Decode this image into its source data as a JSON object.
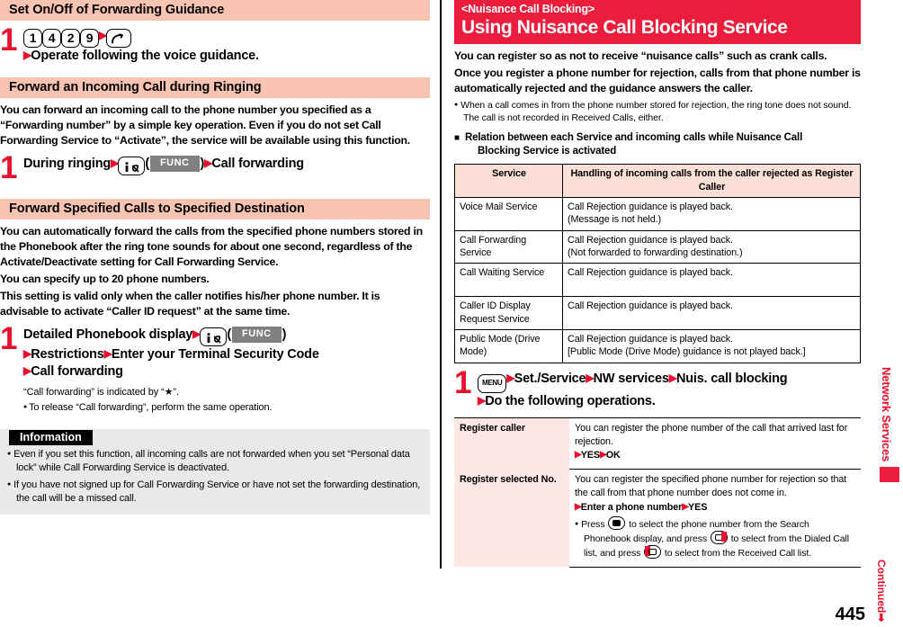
{
  "page": {
    "number": "445",
    "side_tab": "Network Services",
    "continued": "Continued"
  },
  "left": {
    "section1": {
      "heading": "Set On/Off of Forwarding Guidance",
      "step_number": "1",
      "keys": [
        "1",
        "4",
        "2",
        "9"
      ],
      "call_key": "call-key",
      "line2": "Operate following the voice guidance."
    },
    "section2": {
      "heading": "Forward an Incoming Call during Ringing",
      "body": "You can forward an incoming call to the phone number you specified as a “Forwarding number” by a simple key operation. Even if you do not set Call Forwarding Service to “Activate”, the service will be available using this function.",
      "step_number": "1",
      "step_part1": "During ringing",
      "func_label": "FUNC",
      "step_part2": "Call forwarding"
    },
    "section3": {
      "heading": "Forward Specified Calls to Specified Destination",
      "body1": "You can automatically forward the calls from the specified phone numbers stored in the Phonebook after the ring tone sounds for about one second, regardless of the Activate/Deactivate setting for Call Forwarding Service.",
      "body2": "You can specify up to 20 phone numbers.",
      "body3": "This setting is valid only when the caller notifies his/her phone number. It is advisable to activate “Caller ID request” at the same time.",
      "step_number": "1",
      "step_line1a": "Detailed Phonebook display",
      "func_label": "FUNC",
      "step_line2a": "Restrictions",
      "step_line2b": "Enter your Terminal Security Code",
      "step_line3": "Call forwarding",
      "note1": "“Call forwarding” is indicated by “★”.",
      "note2": "To release “Call forwarding”, perform the same operation."
    },
    "information": {
      "label": "Information",
      "items": [
        "Even if you set this function, all incoming calls are not forwarded when you set “Personal data lock” while Call Forwarding Service is deactivated.",
        "If you have not signed up for Call Forwarding Service or have not set the forwarding destination, the call will be a missed call."
      ]
    }
  },
  "right": {
    "banner": {
      "subtitle": "<Nuisance Call Blocking>",
      "title": "Using Nuisance Call Blocking Service"
    },
    "body1": "You can register so as not to receive “nuisance calls” such as crank calls.",
    "body2": "Once you register a phone number for rejection, calls from that phone number is automatically rejected and the guidance answers the caller.",
    "note1": "When a call comes in from the phone number stored for rejection, the ring tone does not sound. The call is not recorded in Received Calls, either.",
    "square_heading_line1": "Relation between each Service and incoming calls while Nuisance Call",
    "square_heading_line2": "Blocking Service is activated",
    "table1": {
      "headers": [
        "Service",
        "Handling of incoming calls from the caller rejected as Register Caller"
      ],
      "rows": [
        {
          "service": "Voice Mail Service",
          "handling": [
            "Call Rejection guidance is played back.",
            "(Message is not held.)"
          ]
        },
        {
          "service": "Call Forwarding Service",
          "handling": [
            "Call Rejection guidance is played back.",
            "(Not forwarded to forwarding destination.)"
          ]
        },
        {
          "service": "Call Waiting Service",
          "handling": [
            "Call Rejection guidance is played back."
          ]
        },
        {
          "service": "Caller ID Display Request Service",
          "handling": [
            "Call Rejection guidance is played back."
          ]
        },
        {
          "service": "Public Mode (Drive Mode)",
          "handling": [
            "Call Rejection guidance is played back.",
            "[Public Mode (Drive Mode) guidance is not played back.]"
          ]
        }
      ]
    },
    "step": {
      "number": "1",
      "menu_key": "MENU",
      "item1": "Set./Service",
      "item2": "NW services",
      "item3": "Nuis. call blocking",
      "item4": "Do the following operations."
    },
    "table2": {
      "rows": [
        {
          "key": "Register caller",
          "desc": "You can register the phone number of the call that arrived last for rejection.",
          "ops": [
            "YES",
            "OK"
          ],
          "extra": []
        },
        {
          "key": "Register selected No.",
          "desc": "You can register the specified phone number for rejection so that the call from that phone number does not come in.",
          "ops": [
            "Enter a phone number",
            "YES"
          ],
          "extra": [
            "Press ",
            " to select the phone number from the Search Phonebook display, and press ",
            " to select from the Dialed Call list, and press ",
            " to select from the Received Call list."
          ]
        }
      ]
    }
  }
}
